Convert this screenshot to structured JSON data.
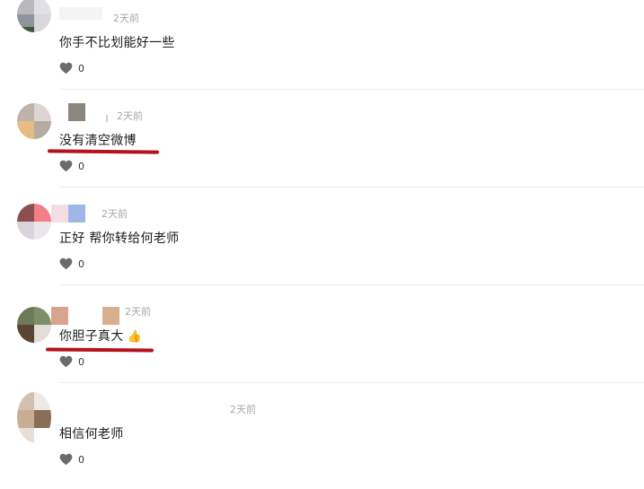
{
  "comments": [
    {
      "time": "2天前",
      "text": "你手不比划能好一些",
      "likes": "0"
    },
    {
      "time": "2天前",
      "text": "没有清空微博",
      "likes": "0"
    },
    {
      "time": "2天前",
      "text": "正好 帮你转给何老师",
      "likes": "0"
    },
    {
      "time": "2天前",
      "text": "你胆子真大",
      "likes": "0",
      "emoji": "👍"
    },
    {
      "time": "2天前",
      "text": "相信何老师",
      "likes": "0"
    }
  ],
  "colors": {
    "underline": "#b5121b",
    "heart": "#6b6b6b",
    "time": "#a8a8a8"
  },
  "icons": {
    "like": "heart-icon",
    "emoji": "thumbs-up-icon"
  }
}
